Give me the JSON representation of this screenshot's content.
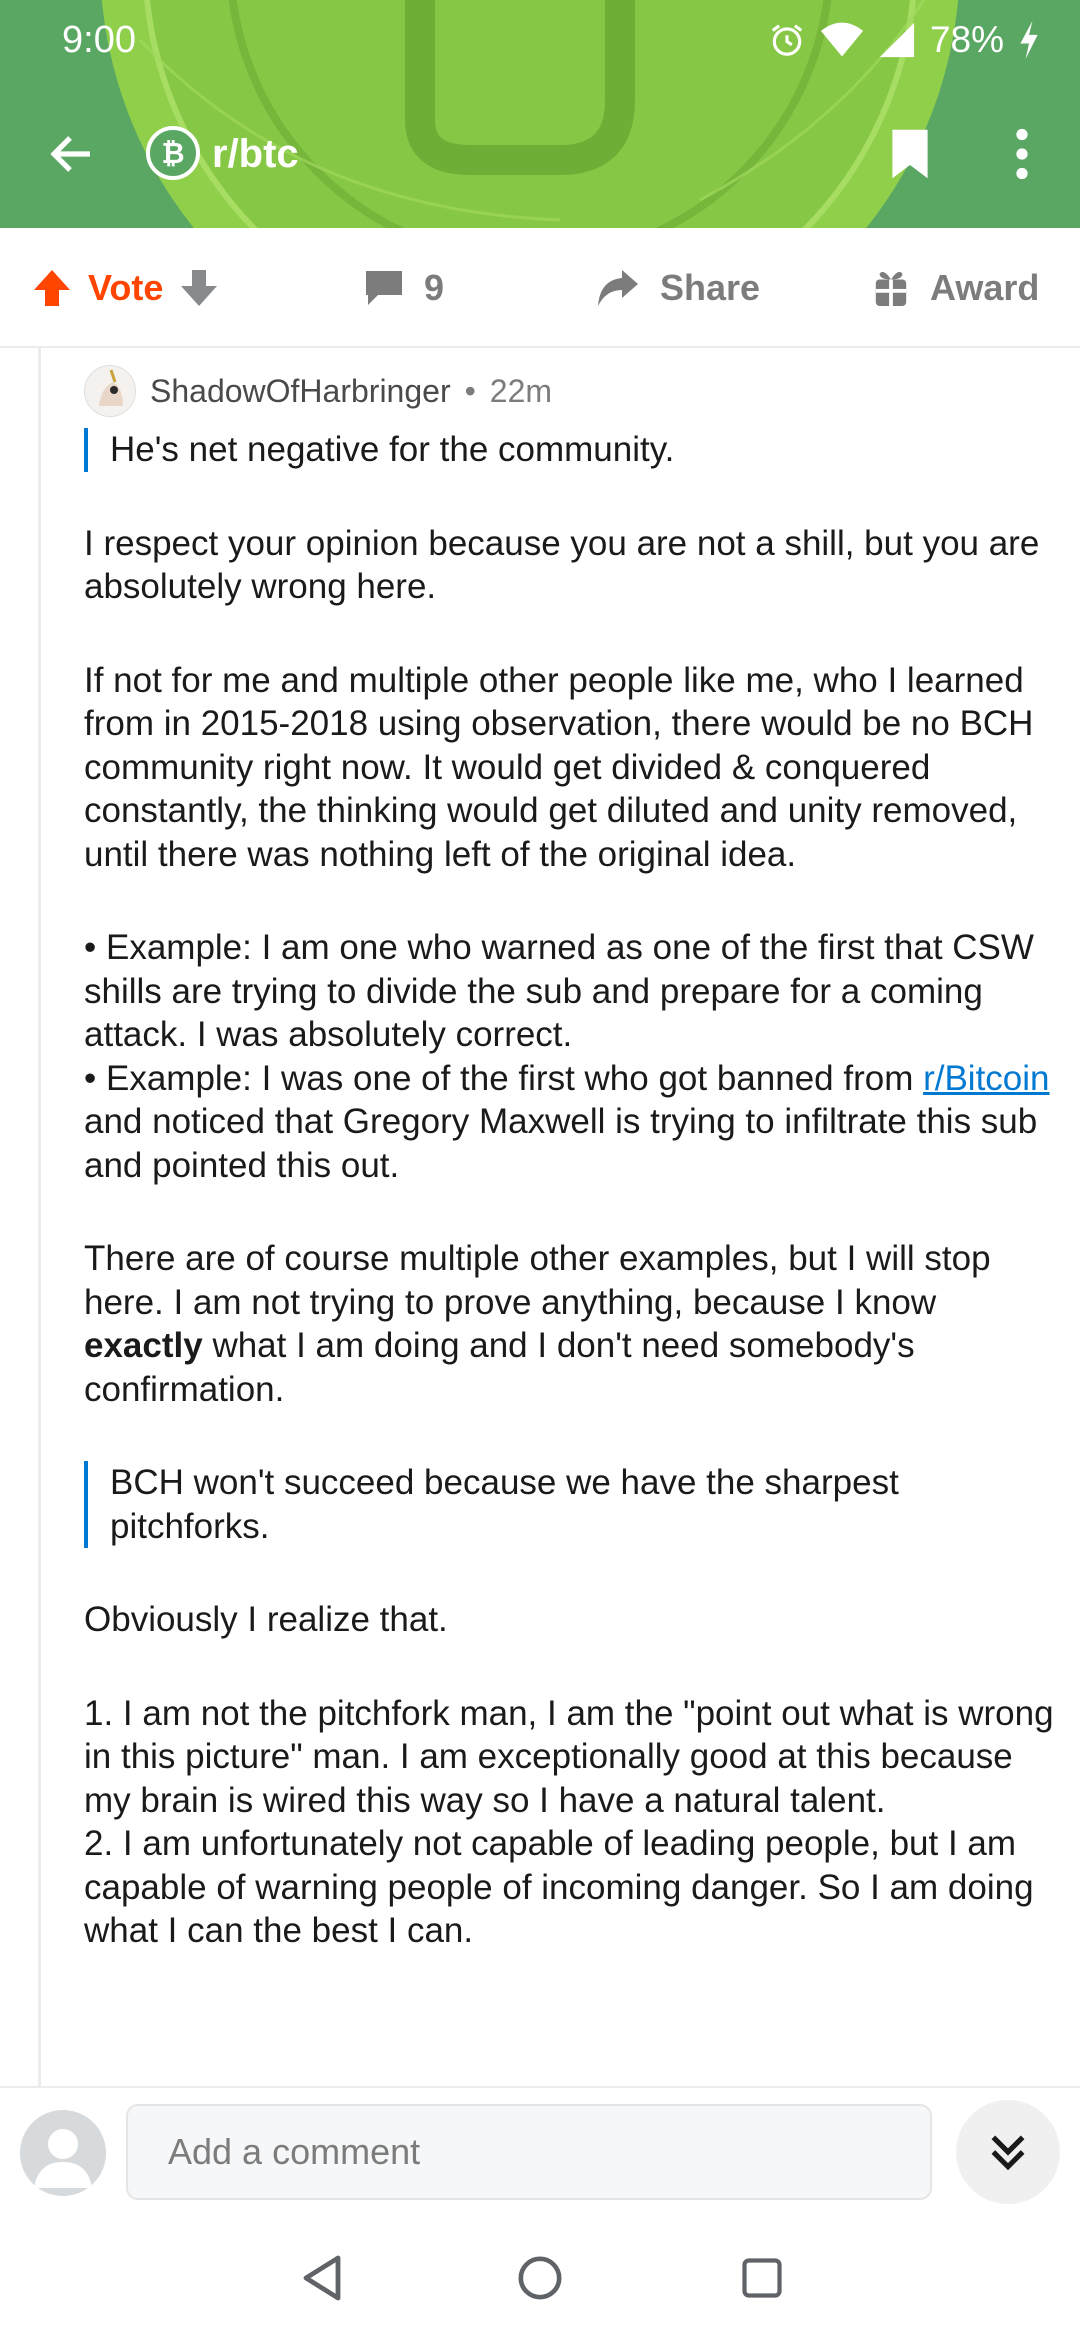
{
  "status_bar": {
    "time": "9:00",
    "battery": "78%",
    "icons": [
      "alarm-icon",
      "wifi-icon",
      "signal-icon",
      "charging-icon"
    ]
  },
  "header": {
    "subreddit": "r/btc",
    "icons": [
      "back-arrow-icon",
      "bitcoin-icon",
      "bookmark-icon",
      "more-vertical-icon"
    ]
  },
  "actions": {
    "vote_label": "Vote",
    "comment_count": "9",
    "share_label": "Share",
    "award_label": "Award"
  },
  "comment": {
    "author": "ShadowOfHarbringer",
    "dot": "•",
    "time": "22m",
    "quote1": "He's net negative for the community.",
    "para1": "I respect your opinion because you are not a shill, but you are absolutely wrong here.",
    "para2": "If not for me and multiple other people like me, who I learned from in 2015-2018 using observation, there would be no BCH community right now. It would get divided & conquered constantly, the thinking would get diluted and unity removed, until there was nothing left of the original idea.",
    "bullet1": "• Example: I am one who warned as one of the first that CSW shills are trying to divide the sub and prepare for a coming attack. I was absolutely correct.",
    "bullet2_before": "• Example: I was one of the first who got banned from ",
    "bullet2_link": "r/Bitcoin",
    "bullet2_after": " and noticed that Gregory Maxwell is trying to infiltrate this sub and pointed this out.",
    "para3_before": "There are of course multiple other examples, but I will stop here. I am not trying to prove anything, because I know ",
    "para3_bold": "exactly",
    "para3_after": " what I am doing and I don't need somebody's confirmation.",
    "quote2": "BCH won't succeed because we have the sharpest pitchforks.",
    "para4": "Obviously I realize that.",
    "item1": "1. I am not the pitchfork man, I am the \"point out what is wrong in this picture\" man. I am exceptionally good at this because my brain is wired this way so I have a natural talent.",
    "item2": "2. I am unfortunately not capable of leading people, but I am capable of warning people of incoming danger. So I am doing what I can the best I can."
  },
  "bottom": {
    "placeholder": "Add a comment"
  },
  "colors": {
    "header_green": "#5aa764",
    "upvote_orange": "#ff4500",
    "link_blue": "#0079d3",
    "muted_gray": "#7c7c7c"
  }
}
